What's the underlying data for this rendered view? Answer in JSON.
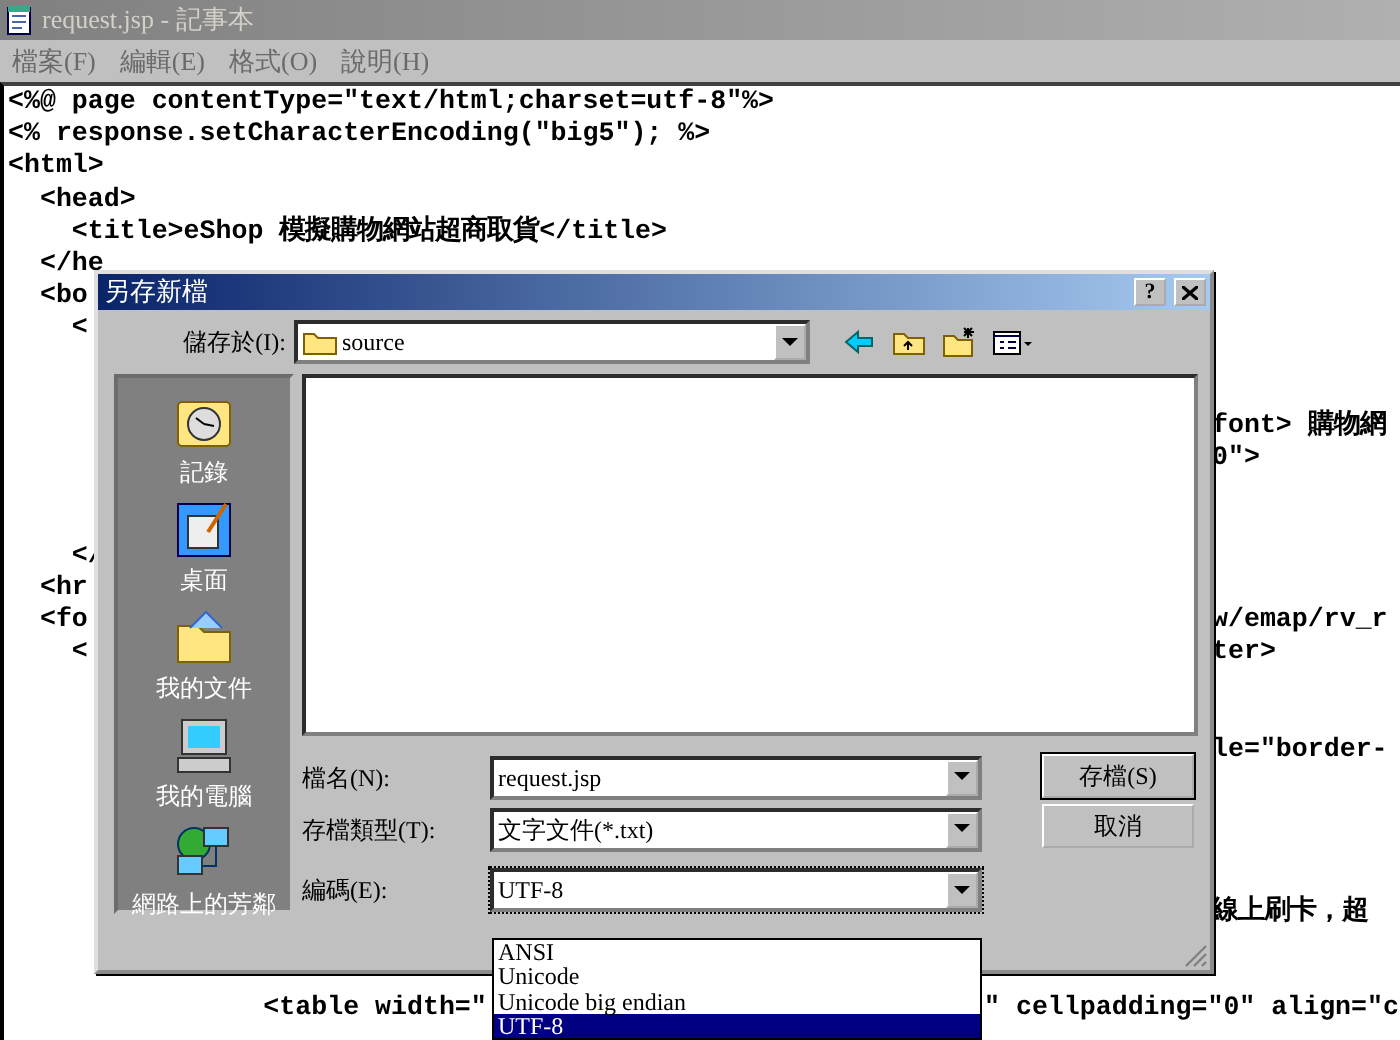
{
  "window": {
    "title": "request.jsp - 記事本"
  },
  "menu": [
    "檔案(F)",
    "編輯(E)",
    "格式(O)",
    "說明(H)"
  ],
  "editor": {
    "lines": [
      {
        "text": "<%@ page contentType=\"text/html;charset=utf-8\"%>"
      },
      {
        "text": "<% response.setCharacterEncoding(\"big5\"); %>"
      },
      {
        "text": "<html>"
      },
      {
        "text": "  <head>"
      },
      {
        "text": "    <title>eShop 模擬購物網站超商取貨</title>"
      },
      {
        "text": "  </he"
      },
      {
        "text": "  <bo"
      },
      {
        "text": "    <"
      },
      {
        "tail": "font> 購物網",
        "kind": "dialog"
      },
      {
        "tail": "0\">",
        "kind": "dialog"
      },
      {
        "text": "    </"
      },
      {
        "text": "  <hr"
      },
      {
        "text": "  <fo",
        "tail": "w/emap/rv_r",
        "kind": "dialog"
      },
      {
        "text": "    <",
        "tail": "ter>",
        "kind": "dialog"
      },
      {
        "tail": "le=\"border-",
        "kind": "dialog"
      },
      {
        "tail": "線上刷卡，超",
        "kind": "dialog"
      },
      {
        "text": "                <table width=\"",
        "tail": "\" cellpadding=\"0\" align=\"c",
        "kind": "list"
      }
    ]
  },
  "dialog": {
    "title": "另存新檔",
    "help": "?",
    "save_in": {
      "label": "儲存於(I):",
      "value": "source"
    },
    "places": [
      {
        "label": "記錄",
        "kind": "history"
      },
      {
        "label": "桌面",
        "kind": "desktop"
      },
      {
        "label": "我的文件",
        "kind": "documents"
      },
      {
        "label": "我的電腦",
        "kind": "computer"
      },
      {
        "label": "網路上的芳鄰",
        "kind": "network"
      }
    ],
    "fields": [
      {
        "label": "檔名(N):",
        "value": "request.jsp",
        "expanded": false
      },
      {
        "label": "存檔類型(T):",
        "value": "文字文件(*.txt)",
        "expanded": false
      },
      {
        "label": "編碼(E):",
        "value": "UTF-8",
        "expanded": true,
        "options": [
          {
            "label": "ANSI",
            "selected": false
          },
          {
            "label": "Unicode",
            "selected": false
          },
          {
            "label": "Unicode big endian",
            "selected": false
          },
          {
            "label": "UTF-8",
            "selected": true
          }
        ]
      }
    ],
    "buttons": [
      {
        "label": "存檔(S)",
        "default": true
      },
      {
        "label": "取消",
        "default": false
      }
    ]
  }
}
